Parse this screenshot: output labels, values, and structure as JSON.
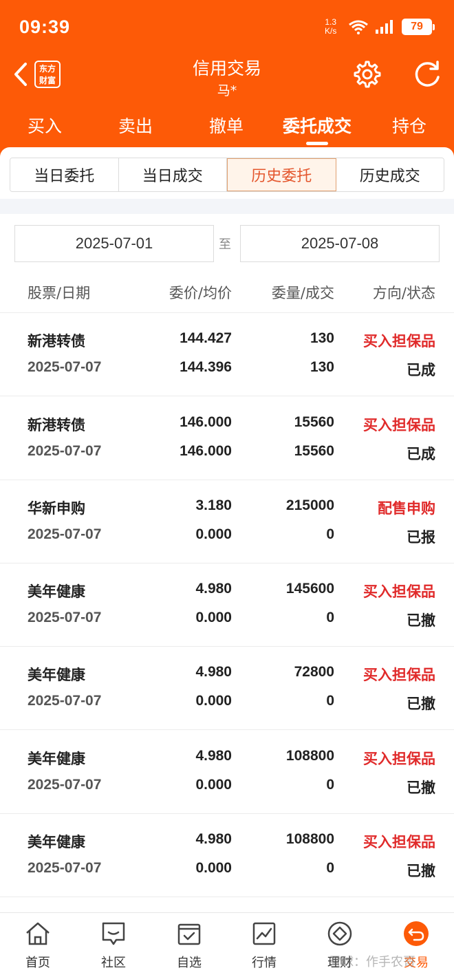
{
  "status_bar": {
    "time": "09:39",
    "net_speed_value": "1.3",
    "net_speed_unit": "K/s",
    "battery": "79"
  },
  "header": {
    "brand_line1": "东方",
    "brand_line2": "财富",
    "title": "信用交易",
    "subtitle": "马*"
  },
  "main_tabs": [
    "买入",
    "卖出",
    "撤单",
    "委托成交",
    "持仓"
  ],
  "sub_tabs": [
    "当日委托",
    "当日成交",
    "历史委托",
    "历史成交"
  ],
  "date_range": {
    "start": "2025-07-01",
    "separator": "至",
    "end": "2025-07-08"
  },
  "columns": [
    "股票/日期",
    "委价/均价",
    "委量/成交",
    "方向/状态"
  ],
  "rows": [
    {
      "name": "新港转债",
      "date": "2025-07-07",
      "price": "144.427",
      "avg": "144.396",
      "qty": "130",
      "filled": "130",
      "direction": "买入担保品",
      "status": "已成"
    },
    {
      "name": "新港转债",
      "date": "2025-07-07",
      "price": "146.000",
      "avg": "146.000",
      "qty": "15560",
      "filled": "15560",
      "direction": "买入担保品",
      "status": "已成"
    },
    {
      "name": "华新申购",
      "date": "2025-07-07",
      "price": "3.180",
      "avg": "0.000",
      "qty": "215000",
      "filled": "0",
      "direction": "配售申购",
      "status": "已报"
    },
    {
      "name": "美年健康",
      "date": "2025-07-07",
      "price": "4.980",
      "avg": "0.000",
      "qty": "145600",
      "filled": "0",
      "direction": "买入担保品",
      "status": "已撤"
    },
    {
      "name": "美年健康",
      "date": "2025-07-07",
      "price": "4.980",
      "avg": "0.000",
      "qty": "72800",
      "filled": "0",
      "direction": "买入担保品",
      "status": "已撤"
    },
    {
      "name": "美年健康",
      "date": "2025-07-07",
      "price": "4.980",
      "avg": "0.000",
      "qty": "108800",
      "filled": "0",
      "direction": "买入担保品",
      "status": "已撤"
    },
    {
      "name": "美年健康",
      "date": "2025-07-07",
      "price": "4.980",
      "avg": "0.000",
      "qty": "108800",
      "filled": "0",
      "direction": "买入担保品",
      "status": "已撤"
    }
  ],
  "bottom_nav": [
    "首页",
    "社区",
    "自选",
    "行情",
    "理财",
    "交易"
  ],
  "watermark": "雪球：作手农哥",
  "colors": {
    "brand_orange": "#fd5a07",
    "direction_red": "#e02a2a",
    "active_subtab_text": "#e4572e"
  }
}
